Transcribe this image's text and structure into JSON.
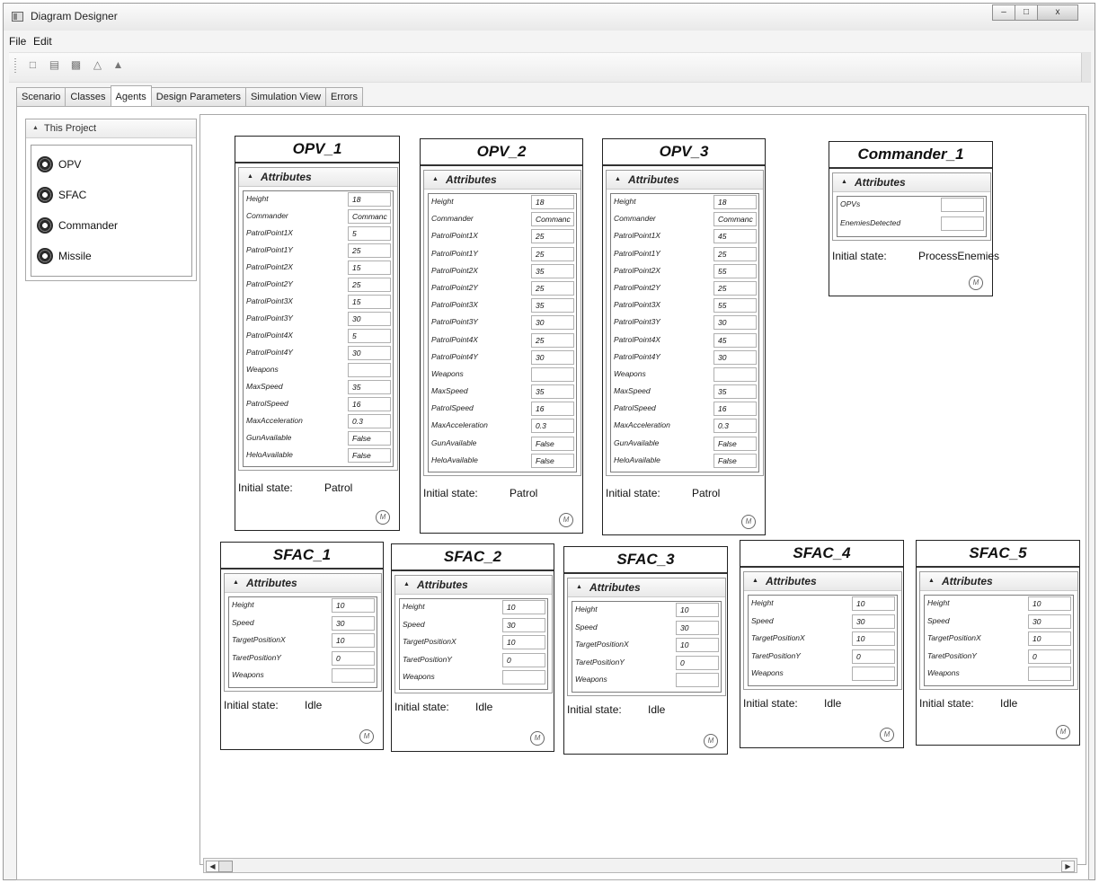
{
  "window": {
    "title": "Diagram Designer",
    "buttons": {
      "minimize": "–",
      "maximize": "□",
      "close": "x"
    }
  },
  "menu": {
    "file": "File",
    "edit": "Edit"
  },
  "toolbar": {
    "icons": [
      "new-icon",
      "open-icon",
      "save-icon",
      "print-icon",
      "export-icon"
    ]
  },
  "tabs": [
    "Scenario",
    "Classes",
    "Agents",
    "Design Parameters",
    "Simulation View",
    "Errors"
  ],
  "active_tab": "Agents",
  "project": {
    "header": "This Project",
    "items": [
      "OPV",
      "SFAC",
      "Commander",
      "Missile"
    ]
  },
  "labels": {
    "attributes": "Attributes",
    "initial_state": "Initial state:"
  },
  "agents": [
    {
      "name": "OPV_1",
      "attributes": [
        [
          "Height",
          "18"
        ],
        [
          "Commander",
          "Commanc"
        ],
        [
          "PatrolPoint1X",
          "5"
        ],
        [
          "PatrolPoint1Y",
          "25"
        ],
        [
          "PatrolPoint2X",
          "15"
        ],
        [
          "PatrolPoint2Y",
          "25"
        ],
        [
          "PatrolPoint3X",
          "15"
        ],
        [
          "PatrolPoint3Y",
          "30"
        ],
        [
          "PatrolPoint4X",
          "5"
        ],
        [
          "PatrolPoint4Y",
          "30"
        ],
        [
          "Weapons",
          ""
        ],
        [
          "MaxSpeed",
          "35"
        ],
        [
          "PatrolSpeed",
          "16"
        ],
        [
          "MaxAcceleration",
          "0.3"
        ],
        [
          "GunAvailable",
          "False"
        ],
        [
          "HeloAvailable",
          "False"
        ]
      ],
      "initial_state": "Patrol"
    },
    {
      "name": "OPV_2",
      "attributes": [
        [
          "Height",
          "18"
        ],
        [
          "Commander",
          "Commanc"
        ],
        [
          "PatrolPoint1X",
          "25"
        ],
        [
          "PatrolPoint1Y",
          "25"
        ],
        [
          "PatrolPoint2X",
          "35"
        ],
        [
          "PatrolPoint2Y",
          "25"
        ],
        [
          "PatrolPoint3X",
          "35"
        ],
        [
          "PatrolPoint3Y",
          "30"
        ],
        [
          "PatrolPoint4X",
          "25"
        ],
        [
          "PatrolPoint4Y",
          "30"
        ],
        [
          "Weapons",
          ""
        ],
        [
          "MaxSpeed",
          "35"
        ],
        [
          "PatrolSpeed",
          "16"
        ],
        [
          "MaxAcceleration",
          "0.3"
        ],
        [
          "GunAvailable",
          "False"
        ],
        [
          "HeloAvailable",
          "False"
        ]
      ],
      "initial_state": "Patrol"
    },
    {
      "name": "OPV_3",
      "attributes": [
        [
          "Height",
          "18"
        ],
        [
          "Commander",
          "Commanc"
        ],
        [
          "PatrolPoint1X",
          "45"
        ],
        [
          "PatrolPoint1Y",
          "25"
        ],
        [
          "PatrolPoint2X",
          "55"
        ],
        [
          "PatrolPoint2Y",
          "25"
        ],
        [
          "PatrolPoint3X",
          "55"
        ],
        [
          "PatrolPoint3Y",
          "30"
        ],
        [
          "PatrolPoint4X",
          "45"
        ],
        [
          "PatrolPoint4Y",
          "30"
        ],
        [
          "Weapons",
          ""
        ],
        [
          "MaxSpeed",
          "35"
        ],
        [
          "PatrolSpeed",
          "16"
        ],
        [
          "MaxAcceleration",
          "0.3"
        ],
        [
          "GunAvailable",
          "False"
        ],
        [
          "HeloAvailable",
          "False"
        ]
      ],
      "initial_state": "Patrol"
    },
    {
      "name": "Commander_1",
      "attributes": [
        [
          "OPVs",
          ""
        ],
        [
          "EnemiesDetected",
          ""
        ]
      ],
      "initial_state": "ProcessEnemies"
    },
    {
      "name": "SFAC_1",
      "attributes": [
        [
          "Height",
          "10"
        ],
        [
          "Speed",
          "30"
        ],
        [
          "TargetPositionX",
          "10"
        ],
        [
          "TaretPositionY",
          "0"
        ],
        [
          "Weapons",
          ""
        ]
      ],
      "initial_state": "Idle"
    },
    {
      "name": "SFAC_2",
      "attributes": [
        [
          "Height",
          "10"
        ],
        [
          "Speed",
          "30"
        ],
        [
          "TargetPositionX",
          "10"
        ],
        [
          "TaretPositionY",
          "0"
        ],
        [
          "Weapons",
          ""
        ]
      ],
      "initial_state": "Idle"
    },
    {
      "name": "SFAC_3",
      "attributes": [
        [
          "Height",
          "10"
        ],
        [
          "Speed",
          "30"
        ],
        [
          "TargetPositionX",
          "10"
        ],
        [
          "TaretPositionY",
          "0"
        ],
        [
          "Weapons",
          ""
        ]
      ],
      "initial_state": "Idle"
    },
    {
      "name": "SFAC_4",
      "attributes": [
        [
          "Height",
          "10"
        ],
        [
          "Speed",
          "30"
        ],
        [
          "TargetPositionX",
          "10"
        ],
        [
          "TaretPositionY",
          "0"
        ],
        [
          "Weapons",
          ""
        ]
      ],
      "initial_state": "Idle"
    },
    {
      "name": "SFAC_5",
      "attributes": [
        [
          "Height",
          "10"
        ],
        [
          "Speed",
          "30"
        ],
        [
          "TargetPositionX",
          "10"
        ],
        [
          "TaretPositionY",
          "0"
        ],
        [
          "Weapons",
          ""
        ]
      ],
      "initial_state": "Idle"
    }
  ],
  "logo_letter": "M"
}
